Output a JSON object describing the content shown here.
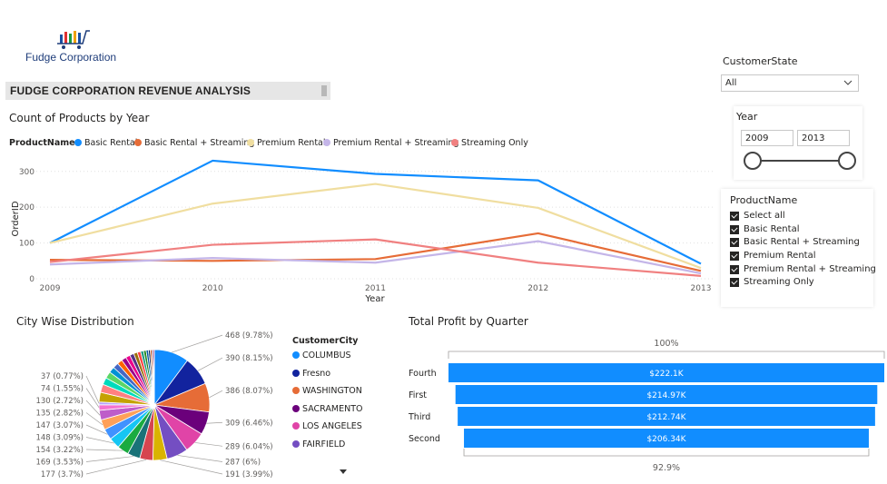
{
  "brand": {
    "name": "Fudge Corporation"
  },
  "report_title": "FUDGE CORPORATION REVENUE ANALYSIS",
  "slicers": {
    "customer_state": {
      "label": "CustomerState",
      "value": "All"
    },
    "year": {
      "label": "Year",
      "start": "2009",
      "end": "2013"
    },
    "product_name": {
      "label": "ProductName",
      "items": [
        {
          "label": "Select all",
          "checked": true
        },
        {
          "label": "Basic Rental",
          "checked": true
        },
        {
          "label": "Basic Rental + Streaming",
          "checked": true
        },
        {
          "label": "Premium Rental",
          "checked": true
        },
        {
          "label": "Premium Rental + Streaming",
          "checked": true
        },
        {
          "label": "Streaming Only",
          "checked": true
        }
      ]
    }
  },
  "chart_data": [
    {
      "type": "line",
      "title": "Count of Products by Year",
      "legend_title": "ProductName",
      "legend_position": "top-left",
      "xlabel": "Year",
      "ylabel": "OrderID",
      "x": [
        "2009",
        "2010",
        "2011",
        "2012",
        "2013"
      ],
      "ylim": [
        0,
        340
      ],
      "yticks": [
        "0",
        "100",
        "200",
        "300"
      ],
      "grid": true,
      "series": [
        {
          "name": "Basic Rental",
          "color": "#118DFF",
          "values": [
            100,
            330,
            293,
            275,
            42
          ]
        },
        {
          "name": "Basic Rental + Streaming",
          "color": "#E66C37",
          "values": [
            53,
            50,
            55,
            127,
            22
          ]
        },
        {
          "name": "Premium Rental",
          "color": "#F0DEA0",
          "values": [
            100,
            210,
            265,
            198,
            30
          ]
        },
        {
          "name": "Premium Rental + Streaming",
          "color": "#C4B5E8",
          "values": [
            40,
            58,
            45,
            105,
            15
          ]
        },
        {
          "name": "Streaming Only",
          "color": "#F08080",
          "values": [
            47,
            95,
            110,
            45,
            8
          ]
        }
      ]
    },
    {
      "type": "pie",
      "title": "City Wise Distribution",
      "legend_title": "CustomerCity",
      "legend_position": "right",
      "legend": [
        {
          "name": "COLUMBUS",
          "color": "#118DFF"
        },
        {
          "name": "Fresno",
          "color": "#12239E"
        },
        {
          "name": "WASHINGTON",
          "color": "#E66C37"
        },
        {
          "name": "SACRAMENTO",
          "color": "#6B007B"
        },
        {
          "name": "LOS ANGELES",
          "color": "#E044A7"
        },
        {
          "name": "FAIRFIELD",
          "color": "#744EC2"
        }
      ],
      "slices": [
        {
          "value": 468,
          "label": "468 (9.78%)",
          "color": "#118DFF"
        },
        {
          "value": 390,
          "label": "390 (8.15%)",
          "color": "#12239E"
        },
        {
          "value": 386,
          "label": "386 (8.07%)",
          "color": "#E66C37"
        },
        {
          "value": 309,
          "label": "309 (6.46%)",
          "color": "#6B007B"
        },
        {
          "value": 289,
          "label": "289 (6.04%)",
          "color": "#E044A7"
        },
        {
          "value": 287,
          "label": "287 (6%)",
          "color": "#744EC2"
        },
        {
          "value": 191,
          "label": "191 (3.99%)",
          "color": "#D9B300"
        },
        {
          "value": 177,
          "label": "177 (3.7%)",
          "color": "#D64550"
        },
        {
          "value": 169,
          "label": "169 (3.53%)",
          "color": "#197278"
        },
        {
          "value": 154,
          "label": "154 (3.22%)",
          "color": "#1AAB40"
        },
        {
          "value": 148,
          "label": "148 (3.09%)",
          "color": "#15C6F4"
        },
        {
          "value": 147,
          "label": "147 (3.07%)",
          "color": "#4092FF"
        },
        {
          "value": 135,
          "label": "135 (2.82%)",
          "color": "#FFA058"
        },
        {
          "value": 130,
          "label": "130 (2.72%)",
          "color": "#BE5DC9"
        },
        {
          "value": 74,
          "label": "74 (1.55%)",
          "color": "#F472D0"
        },
        {
          "value": 37,
          "label": "37 (0.77%)",
          "color": "#B5A1FF"
        },
        {
          "value": 130,
          "label": "",
          "color": "#C4A200"
        },
        {
          "value": 110,
          "label": "",
          "color": "#FF8080"
        },
        {
          "value": 95,
          "label": "",
          "color": "#00DBBC"
        },
        {
          "value": 90,
          "label": "",
          "color": "#5BD667"
        },
        {
          "value": 80,
          "label": "",
          "color": "#0091D5"
        },
        {
          "value": 75,
          "label": "",
          "color": "#4668C5"
        },
        {
          "value": 70,
          "label": "",
          "color": "#FF6300"
        },
        {
          "value": 65,
          "label": "",
          "color": "#99008A"
        },
        {
          "value": 60,
          "label": "",
          "color": "#EC008C"
        },
        {
          "value": 55,
          "label": "",
          "color": "#533285"
        },
        {
          "value": 50,
          "label": "",
          "color": "#99700A"
        },
        {
          "value": 45,
          "label": "",
          "color": "#FF4141"
        },
        {
          "value": 40,
          "label": "",
          "color": "#1F9A85"
        },
        {
          "value": 35,
          "label": "",
          "color": "#25891C"
        },
        {
          "value": 30,
          "label": "",
          "color": "#0057A2"
        },
        {
          "value": 25,
          "label": "",
          "color": "#002050"
        },
        {
          "value": 22,
          "label": "",
          "color": "#C94F0F"
        },
        {
          "value": 18,
          "label": "",
          "color": "#450F54"
        },
        {
          "value": 15,
          "label": "",
          "color": "#B60064"
        }
      ]
    },
    {
      "type": "bar",
      "orientation": "horizontal",
      "title": "Total Profit by Quarter",
      "categories": [
        "Fourth",
        "First",
        "Third",
        "Second"
      ],
      "values": [
        222.1,
        214.97,
        212.74,
        206.34
      ],
      "value_labels": [
        "$222.1K",
        "$214.97K",
        "$212.74K",
        "$206.34K"
      ],
      "color": "#118DFF",
      "top_label": "100%",
      "bottom_label": "92.9%"
    }
  ]
}
